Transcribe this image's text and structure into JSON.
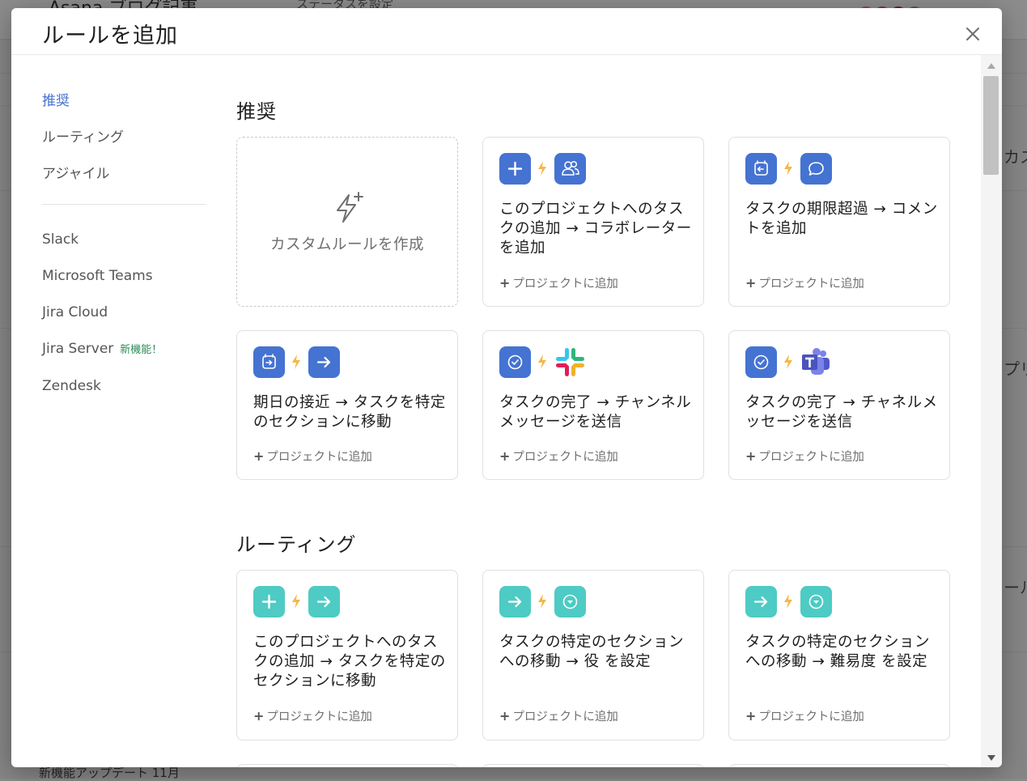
{
  "background": {
    "project_title": "Asana ブログ記事",
    "status_label": "ステータスを設定",
    "update_label": "新機能アップデート 11月",
    "right_fragments": [
      "カス",
      "プリ",
      "ール"
    ]
  },
  "modal": {
    "title": "ルールを追加",
    "close_label": "閉じる"
  },
  "sidebar": {
    "items": [
      {
        "label": "推奨",
        "active": true
      },
      {
        "label": "ルーティング"
      },
      {
        "label": "アジャイル"
      }
    ],
    "integrations": [
      {
        "label": "Slack"
      },
      {
        "label": "Microsoft Teams"
      },
      {
        "label": "Jira Cloud"
      },
      {
        "label": "Jira Server",
        "badge": "新機能！"
      },
      {
        "label": "Zendesk"
      }
    ]
  },
  "sections": {
    "recommended": {
      "title": "推奨",
      "custom_rule_label": "カスタムルールを作成",
      "cards": [
        {
          "text": "このプロジェクトへのタスクの追加 → コラボレーターを追加",
          "action": "プロジェクトに追加",
          "icons": [
            "plus-icon",
            "users-icon"
          ]
        },
        {
          "text": "タスクの期限超過 → コメントを追加",
          "action": "プロジェクトに追加",
          "icons": [
            "calendar-overdue-icon",
            "comment-icon"
          ]
        },
        {
          "text": "期日の接近 → タスクを特定のセクションに移動",
          "action": "プロジェクトに追加",
          "icons": [
            "calendar-due-icon",
            "arrow-right-icon"
          ]
        },
        {
          "text": "タスクの完了 → チャンネルメッセージを送信",
          "action": "プロジェクトに追加",
          "icons": [
            "check-circle-icon",
            "slack-icon"
          ]
        },
        {
          "text": "タスクの完了 → チャネルメッセージを送信",
          "action": "プロジェクトに追加",
          "icons": [
            "check-circle-icon",
            "teams-icon"
          ]
        }
      ]
    },
    "routing": {
      "title": "ルーティング",
      "cards": [
        {
          "text": "このプロジェクトへのタスクの追加 → タスクを特定のセクションに移動",
          "action": "プロジェクトに追加",
          "icons": [
            "plus-icon",
            "arrow-right-icon"
          ]
        },
        {
          "text": "タスクの特定のセクションへの移動 → 役 を設定",
          "action": "プロジェクトに追加",
          "icons": [
            "arrow-right-icon",
            "dropdown-circle-icon"
          ]
        },
        {
          "text": "タスクの特定のセクションへの移動 → 難易度 を設定",
          "action": "プロジェクトに追加",
          "icons": [
            "arrow-right-icon",
            "dropdown-circle-icon"
          ]
        }
      ]
    }
  },
  "colors": {
    "accent_blue": "#4573d2",
    "accent_teal": "#4ecbc4",
    "bolt_yellow": "#f5b74a"
  }
}
